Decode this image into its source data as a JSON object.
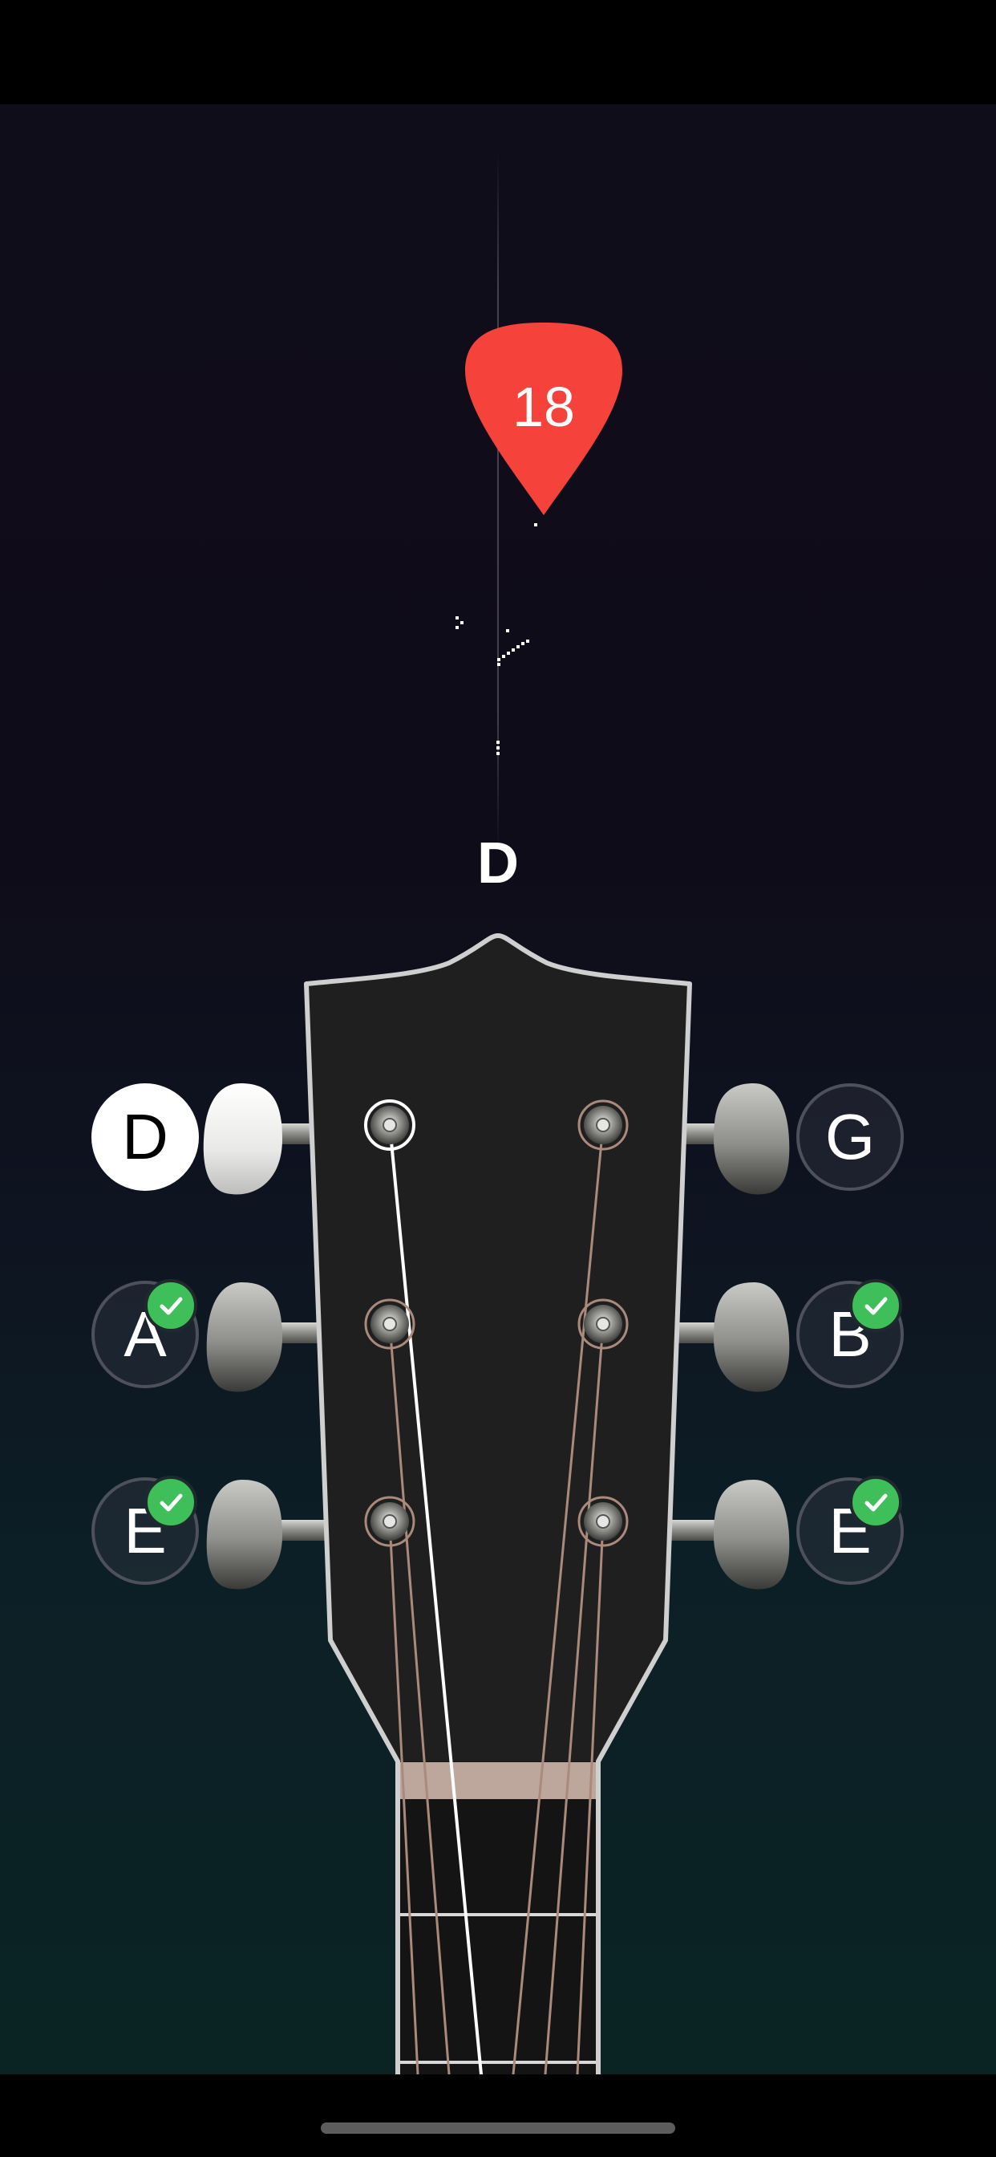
{
  "tuner": {
    "cents_offset": "18",
    "current_note": "D",
    "pick_color": "#f5433b"
  },
  "strings": {
    "left": [
      {
        "note": "D",
        "selected": true,
        "tuned": false
      },
      {
        "note": "A",
        "selected": false,
        "tuned": true
      },
      {
        "note": "E",
        "selected": false,
        "tuned": true
      }
    ],
    "right": [
      {
        "note": "G",
        "selected": false,
        "tuned": false
      },
      {
        "note": "B",
        "selected": false,
        "tuned": true
      },
      {
        "note": "E",
        "selected": false,
        "tuned": true
      }
    ]
  },
  "colors": {
    "background_top": "#100d1a",
    "background_bottom": "#0a2424",
    "tuned_badge": "#3fbf5a",
    "selected_string": "#ffffff"
  },
  "icons": {
    "tuned_badge": "checkmark-icon",
    "pitch_indicator": "guitar-pick-icon"
  }
}
